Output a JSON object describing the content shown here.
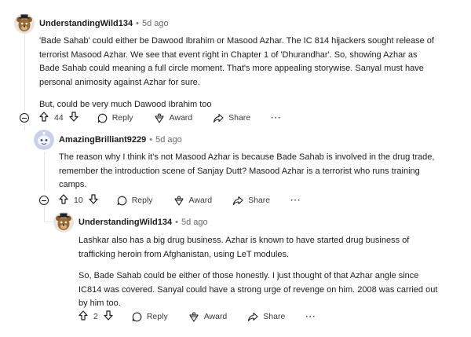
{
  "comments": [
    {
      "username": "UnderstandingWild134",
      "separator": "•",
      "time": "5d ago",
      "avatar": "freddy-bear-avatar",
      "paragraphs": [
        "'Bade Sahab' could either be Dawood Ibrahim or Masood Azhar. The IC 814 hijackers sought release of terrorist Masood Azhar. We see that event right in Chapter 1 of 'Dhurandhar'. So, showing Azhar as Bade Sahab could meaning a full circle moment. That's more appealing storywise. Sanyal must have personal animosity against Azhar for sure.",
        "But, could be very much Dawood Ibrahim too"
      ],
      "votes": "44",
      "actions": {
        "reply": "Reply",
        "award": "Award",
        "share": "Share",
        "more": "···"
      }
    },
    {
      "username": "AmazingBrilliant9229",
      "separator": "•",
      "time": "5d ago",
      "avatar": "snoo-avatar",
      "paragraphs": [
        "The reason why I think it's not Masood Azhar is because Bade Sahab is involved in the drug trade, remember the introduction scene of Sanjay Dutt? Masood Azhar is a terrorist who runs training camps."
      ],
      "votes": "10",
      "actions": {
        "reply": "Reply",
        "award": "Award",
        "share": "Share",
        "more": "···"
      }
    },
    {
      "username": "UnderstandingWild134",
      "separator": "•",
      "time": "5d ago",
      "avatar": "freddy-bear-avatar",
      "paragraphs": [
        "Lashkar also has a big drug business. Azhar is known to have started drug business of trafficking heroin from Afghanistan, using LeT modules.",
        "So, Bade Sahab could be either of those honestly. I just thought of that Azhar angle since IC814 was covered. Sanyal could have a strong urge of revenge on him. 2008 was carried out by him too."
      ],
      "votes": "2",
      "actions": {
        "reply": "Reply",
        "award": "Award",
        "share": "Share",
        "more": "···"
      }
    }
  ]
}
